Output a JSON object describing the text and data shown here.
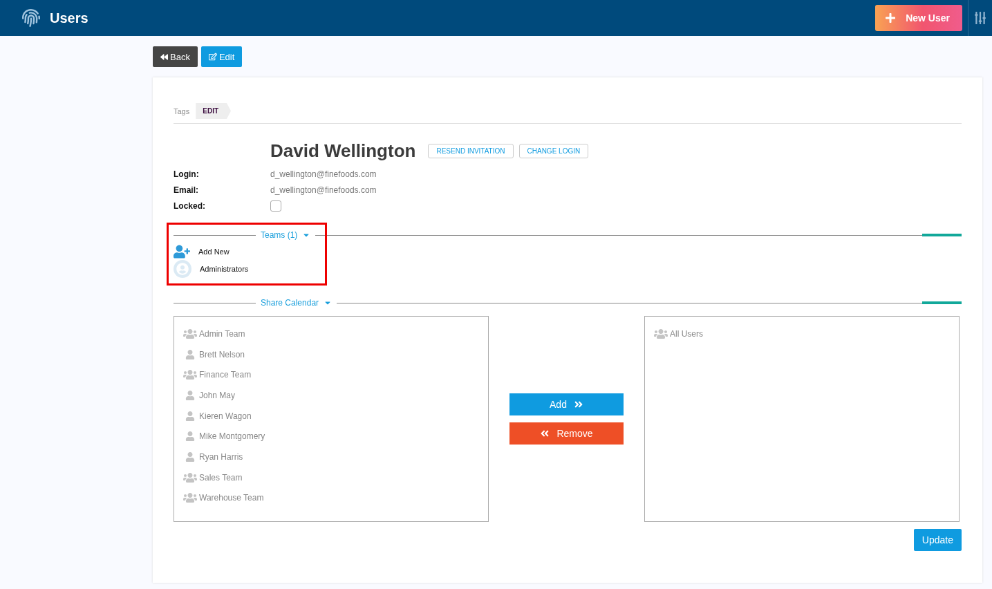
{
  "header": {
    "title": "Users",
    "new_button": "New User"
  },
  "actions": [
    {
      "kind": "back",
      "label": "Back"
    },
    {
      "kind": "edit",
      "label": "Edit"
    }
  ],
  "tags": {
    "label": "Tags",
    "tag": "EDIT"
  },
  "user": {
    "name": "David Wellington",
    "buttons": [
      "RESEND INVITATION",
      "CHANGE LOGIN"
    ],
    "fields": [
      {
        "label": "Login:",
        "value": "d_wellington@finefoods.com"
      },
      {
        "label": "Email:",
        "value": "d_wellington@finefoods.com"
      }
    ],
    "locked": {
      "label": "Locked:",
      "checked": false
    }
  },
  "teams": {
    "title": "Teams (1)",
    "highlighted": true,
    "items": [
      {
        "kind": "add",
        "label": "Add New"
      },
      {
        "kind": "team",
        "label": "Administrators"
      }
    ]
  },
  "share_calendar": {
    "title": "Share Calendar",
    "available": [
      {
        "kind": "team",
        "label": "Admin Team"
      },
      {
        "kind": "user",
        "label": "Brett Nelson"
      },
      {
        "kind": "team",
        "label": "Finance Team"
      },
      {
        "kind": "user",
        "label": "John May"
      },
      {
        "kind": "user",
        "label": "Kieren Wagon"
      },
      {
        "kind": "user",
        "label": "Mike Montgomery"
      },
      {
        "kind": "user",
        "label": "Ryan Harris"
      },
      {
        "kind": "team",
        "label": "Sales Team"
      },
      {
        "kind": "team",
        "label": "Warehouse Team"
      }
    ],
    "add_label": "Add",
    "remove_label": "Remove",
    "selected": [
      {
        "kind": "team",
        "label": "All Users"
      }
    ]
  },
  "update_label": "Update"
}
